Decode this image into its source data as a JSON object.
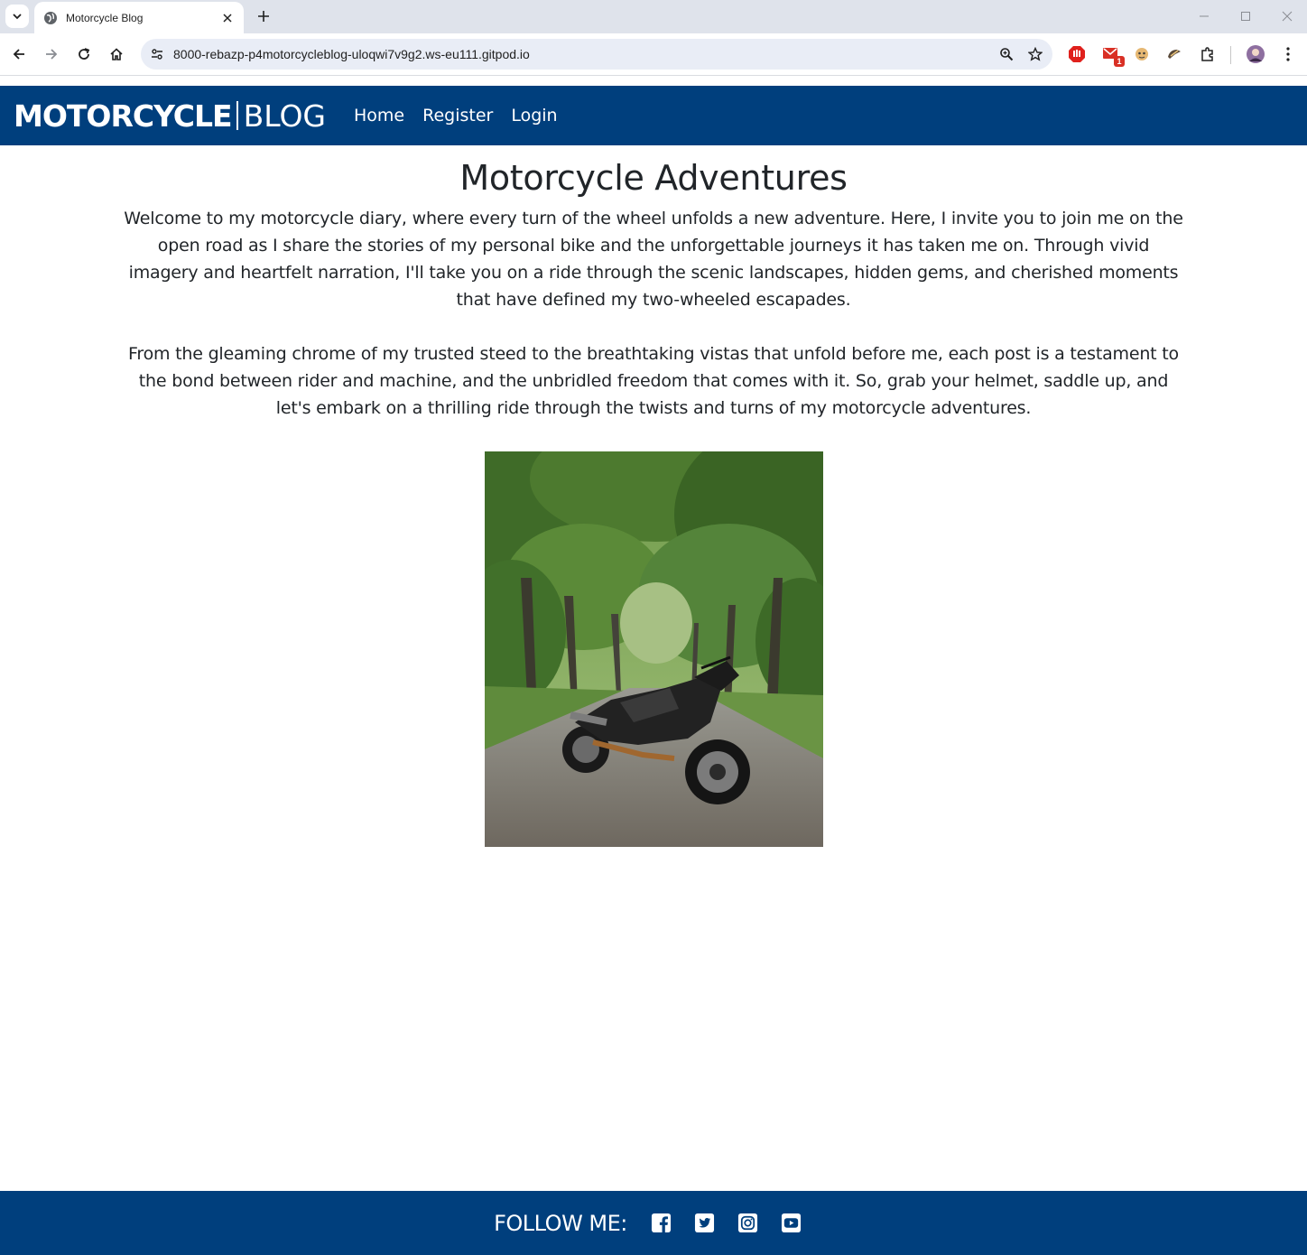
{
  "browser": {
    "tab_title": "Motorcycle Blog",
    "url": "8000-rebazp-p4motorcycleblog-uloqwi7v9g2.ws-eu111.gitpod.io",
    "extension_badge": "1"
  },
  "navbar": {
    "brand_bold": "MOTORCYCLE",
    "brand_thin": "BLOG",
    "links": [
      {
        "label": "Home"
      },
      {
        "label": "Register"
      },
      {
        "label": "Login"
      }
    ],
    "bg_color": "#003f7d"
  },
  "main": {
    "title": "Motorcycle Adventures",
    "paragraphs": [
      "Welcome to my motorcycle diary, where every turn of the wheel unfolds a new adventure. Here, I invite you to join me on the open road as I share the stories of my personal bike and the unforgettable journeys it has taken me on. Through vivid imagery and heartfelt narration, I'll take you on a ride through the scenic landscapes, hidden gems, and cherished moments that have defined my two-wheeled escapades.",
      "From the gleaming chrome of my trusted steed to the breathtaking vistas that unfold before me, each post is a testament to the bond between rider and machine, and the unbridled freedom that comes with it. So, grab your helmet, saddle up, and let's embark on a thrilling ride through the twists and turns of my motorcycle adventures."
    ]
  },
  "footer": {
    "follow_label": "FOLLOW ME:",
    "social_icons": [
      "facebook-icon",
      "twitter-icon",
      "instagram-icon",
      "youtube-icon"
    ]
  }
}
